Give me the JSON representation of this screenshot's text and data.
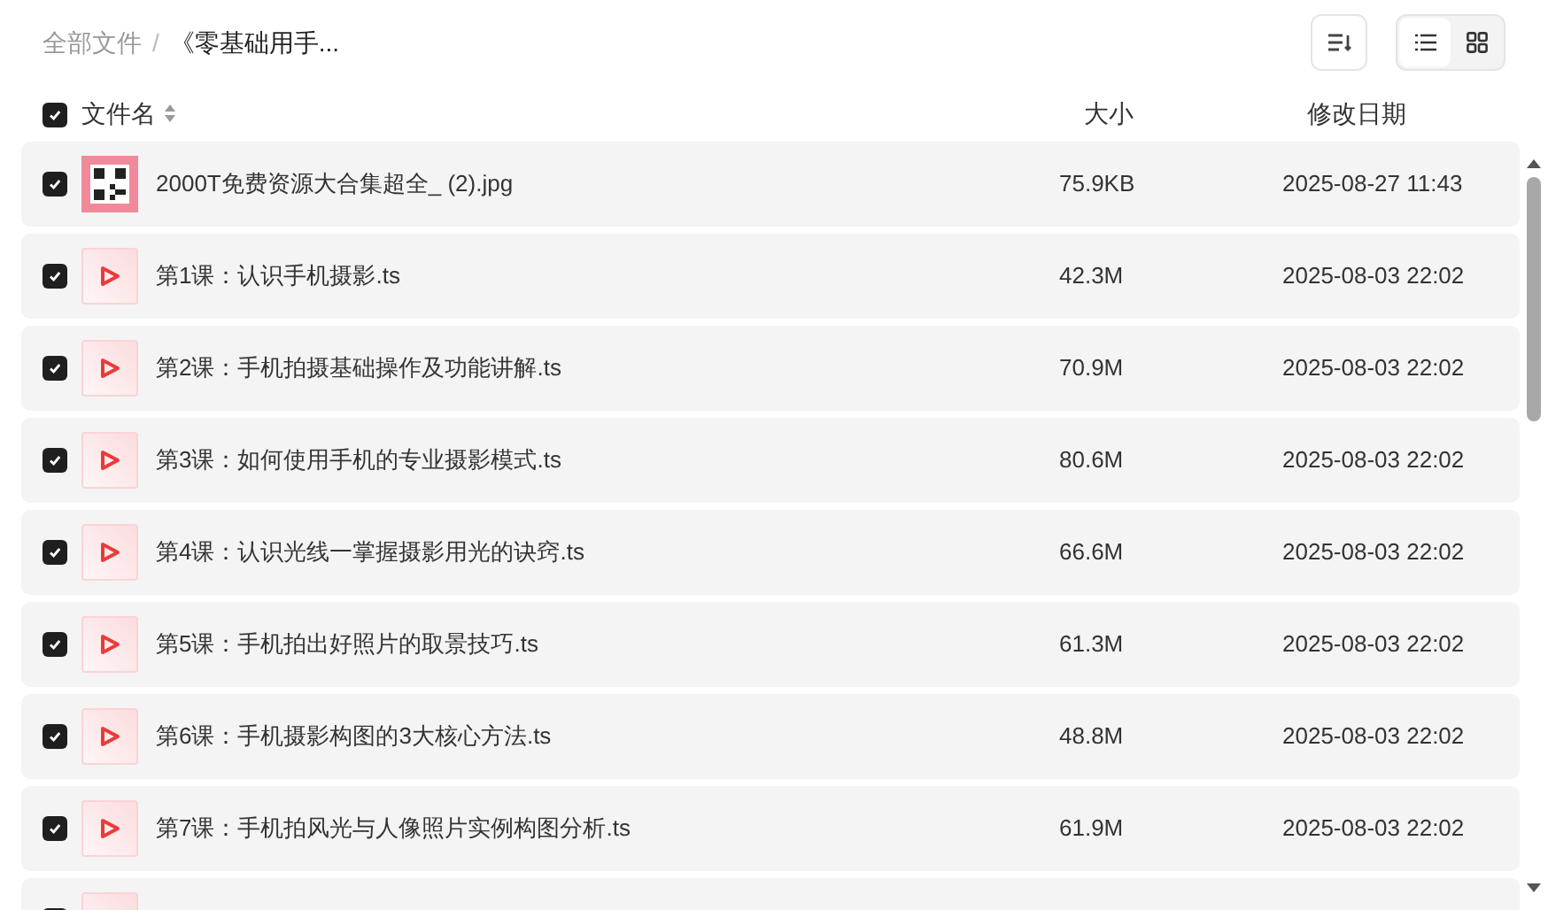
{
  "breadcrumb": [
    {
      "label": "全部文件"
    },
    {
      "label": "《零基础用手..."
    }
  ],
  "breadcrumb_separator": "/",
  "view_toggle": [
    {
      "kind": "list",
      "selected": true
    },
    {
      "kind": "grid",
      "selected": false
    }
  ],
  "header": {
    "select_all_checked": true,
    "columns": [
      "文件名",
      "大小",
      "修改日期"
    ]
  },
  "rows": [
    {
      "kind": "image",
      "checked": true,
      "name": "2000T免费资源大合集超全_ (2).jpg",
      "size": "75.9KB",
      "date": "2025-08-27 11:43"
    },
    {
      "kind": "video",
      "checked": true,
      "name": "第1课：认识手机摄影.ts",
      "size": "42.3M",
      "date": "2025-08-03 22:02"
    },
    {
      "kind": "video",
      "checked": true,
      "name": "第2课：手机拍摄基础操作及功能讲解.ts",
      "size": "70.9M",
      "date": "2025-08-03 22:02"
    },
    {
      "kind": "video",
      "checked": true,
      "name": "第3课：如何使用手机的专业摄影模式.ts",
      "size": "80.6M",
      "date": "2025-08-03 22:02"
    },
    {
      "kind": "video",
      "checked": true,
      "name": "第4课：认识光线一掌握摄影用光的诀窍.ts",
      "size": "66.6M",
      "date": "2025-08-03 22:02"
    },
    {
      "kind": "video",
      "checked": true,
      "name": "第5课：手机拍出好照片的取景技巧.ts",
      "size": "61.3M",
      "date": "2025-08-03 22:02"
    },
    {
      "kind": "video",
      "checked": true,
      "name": "第6课：手机摄影构图的3大核心方法.ts",
      "size": "48.8M",
      "date": "2025-08-03 22:02"
    },
    {
      "kind": "video",
      "checked": true,
      "name": "第7课：手机拍风光与人像照片实例构图分析.ts",
      "size": "61.9M",
      "date": "2025-08-03 22:02"
    },
    {
      "kind": "video",
      "checked": true
    }
  ]
}
